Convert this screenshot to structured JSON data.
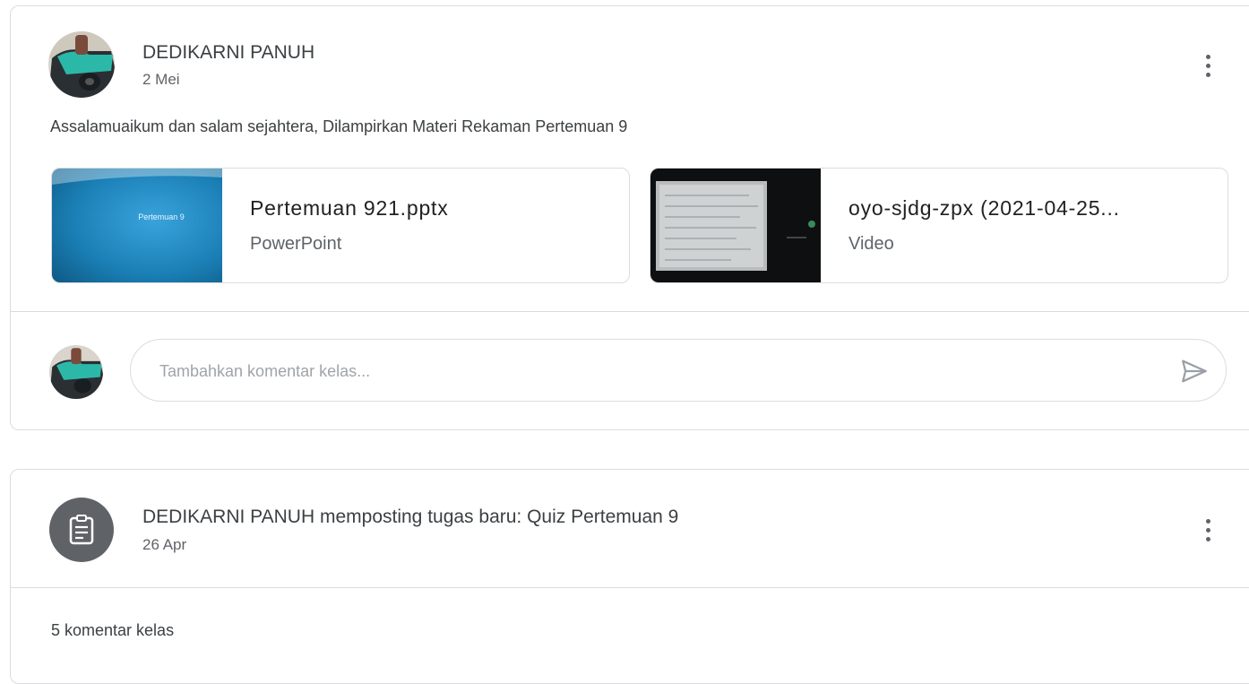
{
  "post": {
    "author": "DEDIKARNI PANUH",
    "date": "2 Mei",
    "text": "Assalamuaikum dan salam sejahtera, Dilampirkan Materi Rekaman Pertemuan 9",
    "attachments": [
      {
        "title": "Pertemuan 921.pptx",
        "type": "PowerPoint",
        "thumb_label": "Pertemuan 9",
        "icon": "powerpoint-thumbnail"
      },
      {
        "title": "oyo-sjdg-zpx (2021-04-25...",
        "type": "Video",
        "icon": "video-thumbnail"
      }
    ],
    "comment_placeholder": "Tambahkan komentar kelas..."
  },
  "assignment": {
    "title": "DEDIKARNI PANUH memposting tugas baru: Quiz Pertemuan 9",
    "date": "26 Apr",
    "comments": "5 komentar kelas",
    "icon": "assignment-icon"
  },
  "colors": {
    "border": "#dadce0",
    "text": "#3c4043",
    "muted": "#5f6368",
    "ppt_blue": "#1a7fb5"
  }
}
